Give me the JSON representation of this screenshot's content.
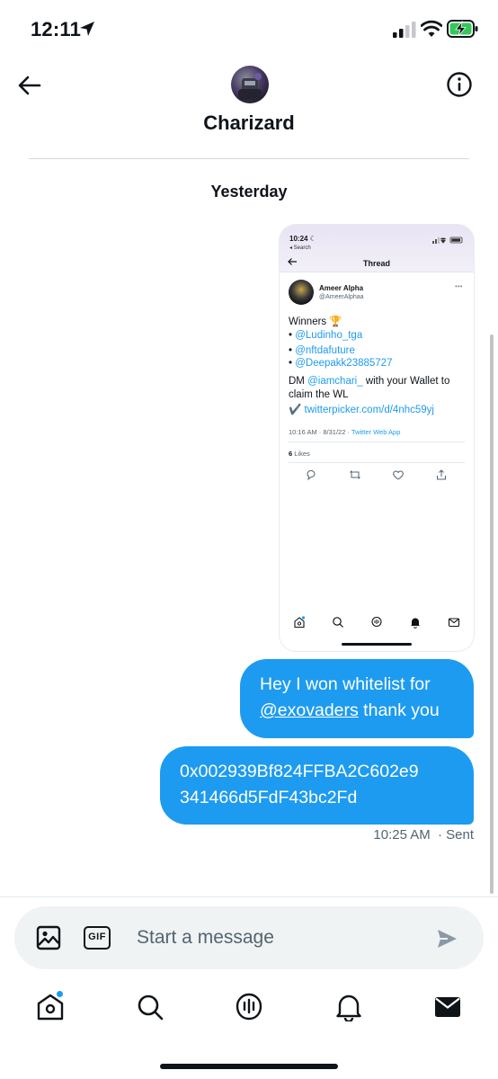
{
  "status_bar": {
    "time": "12:11"
  },
  "header": {
    "title": "Charizard",
    "back_icon": "arrow-left-icon",
    "info_icon": "info-circle-icon"
  },
  "date_separator": "Yesterday",
  "shared_screenshot": {
    "time": "10:24",
    "back_label": "◂ Search",
    "header_title": "Thread",
    "author_name": "Ameer Alpha",
    "author_handle": "@AmeerAlphaa",
    "line_winners": "Winners 🏆",
    "winner_1": "@Ludinho_tga",
    "winner_2": "@nftdafuture",
    "winner_3": "@Deepakk23885727",
    "dm_prefix": "DM ",
    "dm_mention": "@iamchari_",
    "dm_suffix": " with your Wallet to",
    "claim_line": "claim the WL",
    "check_mark": "✔️ ",
    "link": "twitterpicker.com/d/4nhc59yj",
    "meta_date": "10:16 AM · 8/31/22 · ",
    "meta_source": "Twitter Web App",
    "likes_count": "6",
    "likes_label": " Likes",
    "bullet": "• "
  },
  "messages": [
    {
      "line1": "Hey I won whitelist for",
      "mention": "@exovaders",
      "line2_suffix": " thank you"
    },
    {
      "line1": "0x002939Bf824FFBA2C602e9",
      "line2": "341466d5FdF43bc2Fd"
    }
  ],
  "message_meta": {
    "time": "10:25 AM",
    "status": "· Sent"
  },
  "composer": {
    "placeholder": "Start a message",
    "gif_label": "GIF"
  },
  "tab_bar": {
    "tabs": [
      "home-icon",
      "search-icon",
      "spaces-icon",
      "notifications-icon",
      "messages-icon"
    ],
    "active": "messages-icon"
  },
  "colors": {
    "accent": "#1d9bf0",
    "battery_charging": "#34c759"
  }
}
